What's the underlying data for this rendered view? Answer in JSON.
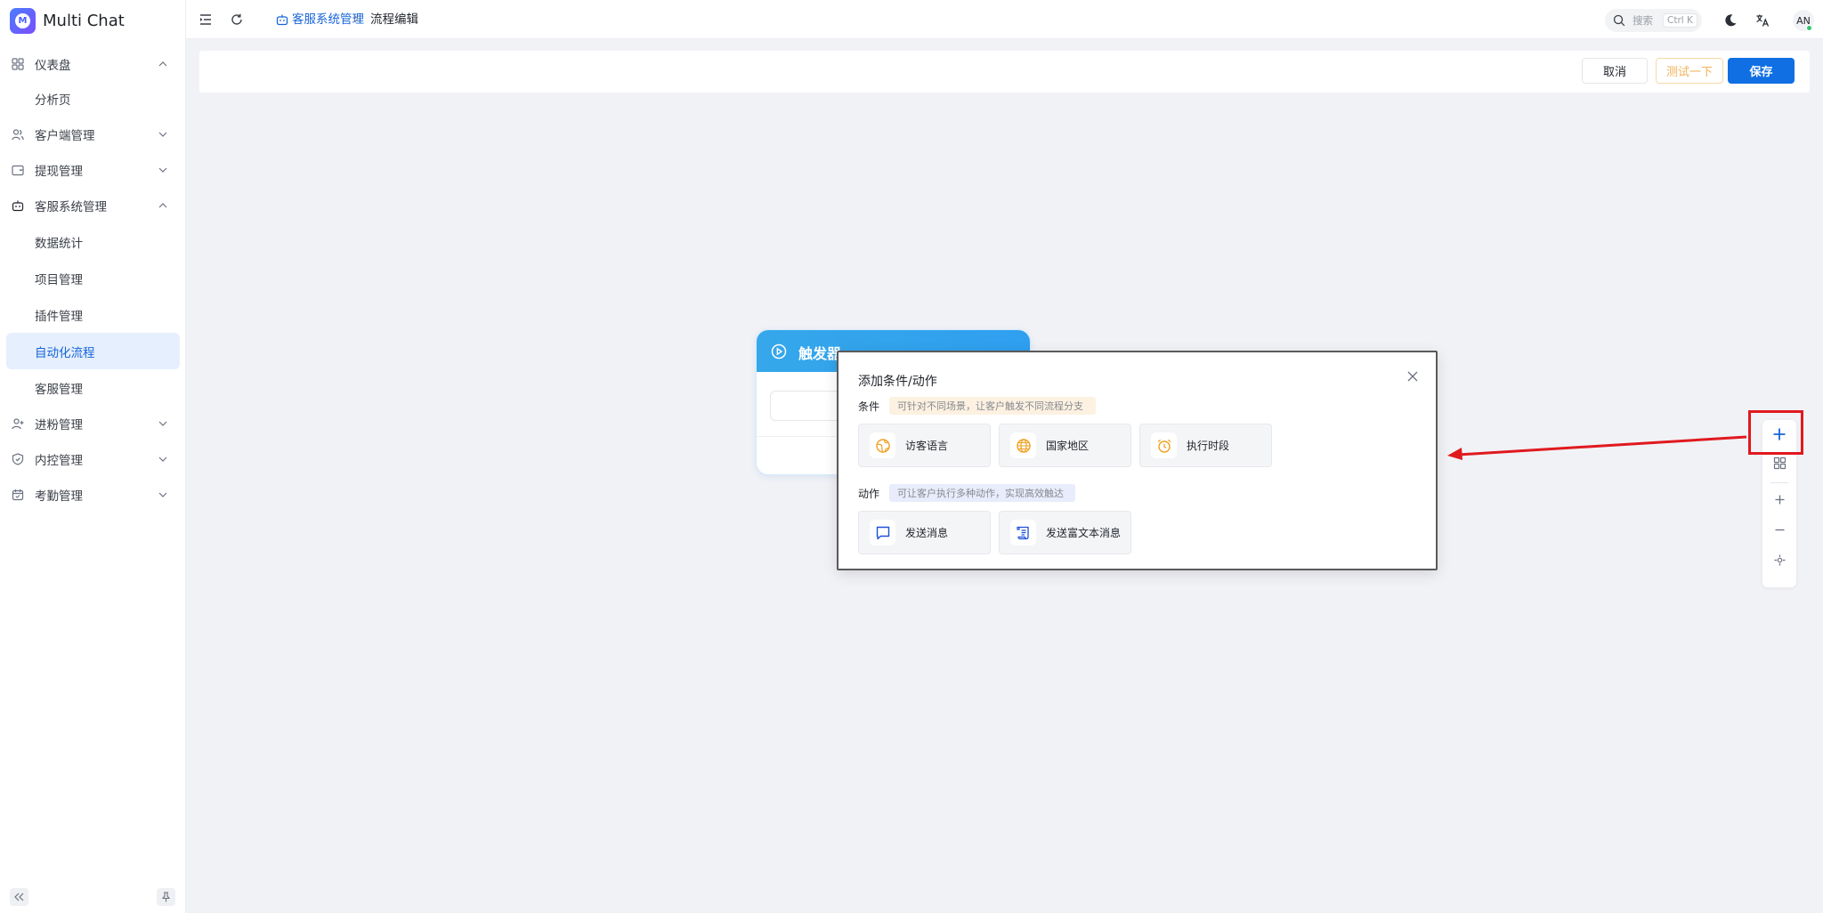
{
  "app": {
    "name": "Multi Chat",
    "logo_letter": "M"
  },
  "sidebar": {
    "items": [
      {
        "label": "仪表盘",
        "icon": "dashboard-icon",
        "expanded": true,
        "children": [
          {
            "label": "分析页"
          }
        ]
      },
      {
        "label": "客户端管理",
        "icon": "users-icon",
        "expanded": false
      },
      {
        "label": "提现管理",
        "icon": "wallet-icon",
        "expanded": false
      },
      {
        "label": "客服系统管理",
        "icon": "robot-icon",
        "expanded": true,
        "children": [
          {
            "label": "数据统计"
          },
          {
            "label": "项目管理"
          },
          {
            "label": "插件管理"
          },
          {
            "label": "自动化流程",
            "active": true
          },
          {
            "label": "客服管理"
          }
        ]
      },
      {
        "label": "进粉管理",
        "icon": "user-add-icon",
        "expanded": false
      },
      {
        "label": "内控管理",
        "icon": "shield-icon",
        "expanded": false
      },
      {
        "label": "考勤管理",
        "icon": "calendar-icon",
        "expanded": false
      }
    ]
  },
  "header": {
    "breadcrumb": [
      "客服系统管理",
      "流程编辑"
    ],
    "search": {
      "placeholder": "搜索",
      "shortcut": "Ctrl K"
    },
    "avatar_initials": "AN"
  },
  "toolbar": {
    "cancel_label": "取消",
    "test_label": "测试一下",
    "save_label": "保存"
  },
  "trigger_node": {
    "title": "触发器"
  },
  "popup": {
    "title": "添加条件/动作",
    "conditions_label": "条件",
    "conditions_hint": "可针对不同场景，让客户触发不同流程分支",
    "conditions": [
      {
        "label": "访客语言",
        "icon": "language-icon"
      },
      {
        "label": "国家地区",
        "icon": "globe-icon"
      },
      {
        "label": "执行时段",
        "icon": "alarm-clock-icon"
      }
    ],
    "actions_label": "动作",
    "actions_hint": "可让客户执行多种动作，实现高效触达",
    "actions": [
      {
        "label": "发送消息",
        "icon": "message-icon"
      },
      {
        "label": "发送富文本消息",
        "icon": "rich-text-icon"
      }
    ]
  },
  "colors": {
    "primary": "#0f6fe3",
    "active_menu_bg": "#e6effd",
    "trigger_header": "#35a7ea",
    "highlight": "#e0191f",
    "condition_icon": "#f0a020",
    "action_icon": "#1f4fd8"
  }
}
